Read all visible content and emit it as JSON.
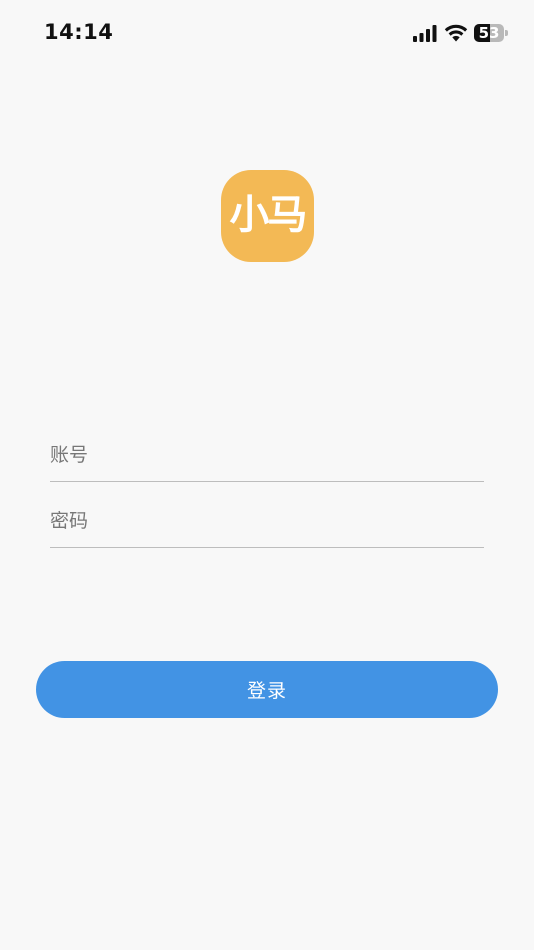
{
  "status_bar": {
    "time": "14:14",
    "battery_level": "53",
    "icons": [
      "signal-icon",
      "wifi-icon",
      "battery-icon"
    ]
  },
  "logo": {
    "text": "小马",
    "color": "#f3b955"
  },
  "form": {
    "account_placeholder": "账号",
    "account_value": "",
    "password_placeholder": "密码",
    "password_value": ""
  },
  "login_button": {
    "label": "登录",
    "color": "#4293e4"
  }
}
